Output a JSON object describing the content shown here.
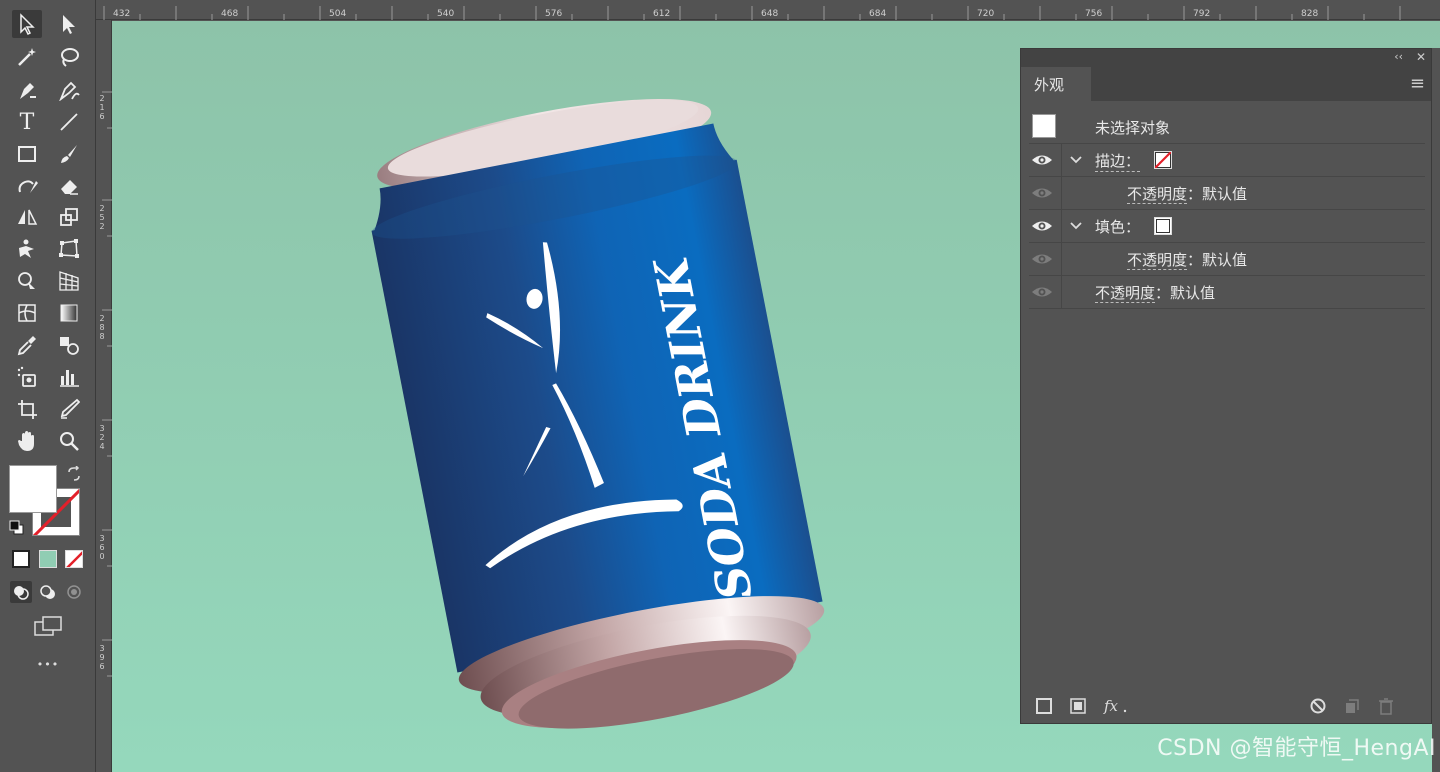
{
  "ruler": {
    "h_ticks": [
      "432",
      "468",
      "504",
      "540",
      "576",
      "612",
      "648",
      "684",
      "720",
      "756",
      "792",
      "828"
    ],
    "v_ticks": [
      "216",
      "252",
      "288",
      "324",
      "360",
      "396"
    ]
  },
  "panel": {
    "title": "外观",
    "collapse_glyph": "‹‹",
    "close_glyph": "✕",
    "menu_glyph": "≡",
    "rows": {
      "no_selection": "未选择对象",
      "stroke_label": "描边",
      "stroke_opacity_label": "不透明度",
      "stroke_opacity_value": "默认值",
      "fill_label": "填色",
      "fill_opacity_label": "不透明度",
      "fill_opacity_value": "默认值",
      "opacity_label": "不透明度",
      "opacity_value": "默认值",
      "colon": "："
    }
  },
  "can": {
    "brand_text": "SODA DRINK"
  },
  "toolbar": {
    "more_glyph": "•••",
    "type_glyph": "T"
  },
  "watermark": "CSDN @智能守恒_HengAI",
  "colors": {
    "canvas": "#90cdb3",
    "can_blue": "#1f5aa0",
    "panel_bg": "#535353",
    "stroke_none_red": "#e3202a"
  }
}
